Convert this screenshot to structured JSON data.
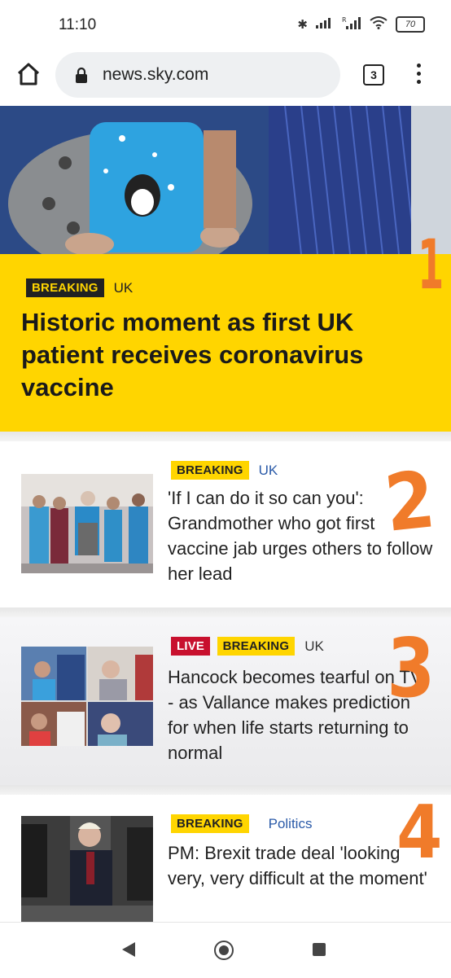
{
  "status_bar": {
    "time": "11:10",
    "battery": "70",
    "icons": [
      "bluetooth-icon",
      "signal-icon",
      "signal-roaming-icon",
      "wifi-icon",
      "battery-icon"
    ]
  },
  "browser": {
    "url": "news.sky.com",
    "tab_count": "3",
    "icons": [
      "home-icon",
      "lock-icon",
      "tabs-icon",
      "more-vert-icon"
    ]
  },
  "hero": {
    "badge": "BREAKING",
    "category": "UK",
    "title": "Historic moment as first UK patient receives coronavirus vaccine"
  },
  "articles": [
    {
      "badges": [
        "BREAKING"
      ],
      "category": "UK",
      "title": "'If I can do it so can you': Grandmother who got first vaccine jab urges others to follow her lead"
    },
    {
      "badges": [
        "LIVE",
        "BREAKING"
      ],
      "category": "UK",
      "title": "Hancock becomes tearful on TV - as Vallance makes prediction for when life starts returning to normal"
    },
    {
      "badges": [
        "BREAKING"
      ],
      "category": "Politics",
      "title": "PM: Brexit trade deal 'looking very, very difficult at the moment'"
    }
  ],
  "annotations": [
    "1",
    "2",
    "3",
    "4"
  ],
  "colors": {
    "sky_yellow": "#ffd500",
    "live_red": "#c8102e",
    "annotation_orange": "#f07b2a",
    "category_blue": "#2a5aa8"
  },
  "nav_bar": {
    "icons": [
      "back-icon",
      "home-circle-icon",
      "recents-icon"
    ]
  }
}
